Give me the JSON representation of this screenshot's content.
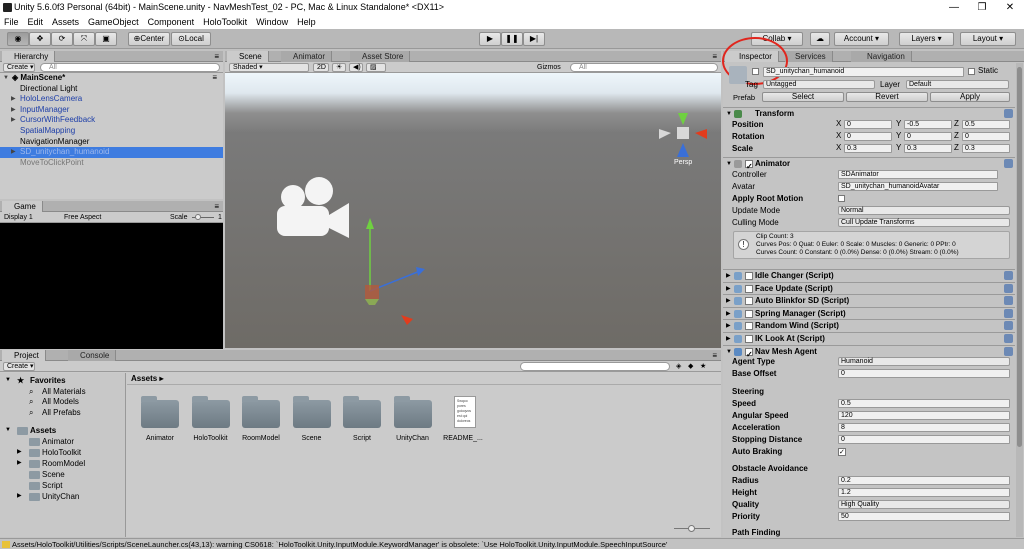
{
  "window": {
    "title": "Unity 5.6.0f3 Personal (64bit) - MainScene.unity - NavMeshTest_02 - PC, Mac & Linux Standalone* <DX11>",
    "min": "—",
    "max": "❐",
    "close": "✕"
  },
  "menu": [
    "File",
    "Edit",
    "Assets",
    "GameObject",
    "Component",
    "HoloToolkit",
    "Window",
    "Help"
  ],
  "toolbar": {
    "center": "Center",
    "local": "Local",
    "collab": "Collab",
    "account": "Account",
    "layers": "Layers",
    "layout": "Layout"
  },
  "hierarchy": {
    "tab": "Hierarchy",
    "create": "Create",
    "search": "All",
    "scene": "MainScene*",
    "items": [
      {
        "label": "Directional Light",
        "style": "normal",
        "arrow": ""
      },
      {
        "label": "HoloLensCamera",
        "style": "blue",
        "arrow": "▶"
      },
      {
        "label": "InputManager",
        "style": "blue",
        "arrow": "▶"
      },
      {
        "label": "CursorWithFeedback",
        "style": "blue",
        "arrow": "▶"
      },
      {
        "label": "SpatialMapping",
        "style": "blue",
        "arrow": ""
      },
      {
        "label": "NavigationManager",
        "style": "normal",
        "arrow": ""
      },
      {
        "label": "SD_unitychan_humanoid",
        "style": "sel",
        "arrow": "▶"
      },
      {
        "label": "MoveToClickPoint",
        "style": "gray",
        "arrow": ""
      }
    ]
  },
  "scene": {
    "tabs": [
      "Scene",
      "Animator",
      "Asset Store"
    ],
    "shaded": "Shaded",
    "mode2d": "2D",
    "gizmos": "Gizmos",
    "search": "All",
    "persp": "Persp"
  },
  "game": {
    "tab": "Game",
    "display": "Display 1",
    "aspect": "Free Aspect",
    "scale": "Scale",
    "scale_val": "1"
  },
  "project": {
    "tabs": [
      "Project",
      "Console"
    ],
    "create": "Create",
    "breadcrumb": "Assets",
    "tree": [
      {
        "label": "Favorites",
        "bold": true
      },
      {
        "label": "All Materials"
      },
      {
        "label": "All Models"
      },
      {
        "label": "All Prefabs"
      },
      {
        "label": "Assets",
        "bold": true
      },
      {
        "label": "Animator"
      },
      {
        "label": "HoloToolkit"
      },
      {
        "label": "RoomModel"
      },
      {
        "label": "Scene"
      },
      {
        "label": "Script"
      },
      {
        "label": "UnityChan"
      }
    ],
    "assets": [
      "Animator",
      "HoloToolkit",
      "RoomModel",
      "Scene",
      "Script",
      "UnityChan",
      "README_..."
    ],
    "readme_preview": "Swqoo pores goioqvos est qoi duloreos"
  },
  "status": "Assets/HoloToolkit/Utilities/Scripts/SceneLauncher.cs(43,13): warning CS0618: `HoloToolkit.Unity.InputModule.KeywordManager' is obsolete: `Use HoloToolkit.Unity.InputModule.SpeechInputSource'",
  "inspector": {
    "tabs": [
      "Inspector",
      "Services",
      "Navigation"
    ],
    "name": "SD_unitychan_humanoid",
    "static": "Static",
    "tag_label": "Tag",
    "tag": "Untagged",
    "layer_label": "Layer",
    "layer": "Default",
    "prefab": "Prefab",
    "select": "Select",
    "revert": "Revert",
    "apply": "Apply",
    "transform": {
      "title": "Transform",
      "position": "Position",
      "rotation": "Rotation",
      "scale": "Scale",
      "px": "0",
      "py": "-0.5",
      "pz": "0.5",
      "rx": "0",
      "ry": "0",
      "rz": "0",
      "sx": "0.3",
      "sy": "0.3",
      "sz": "0.3"
    },
    "animator": {
      "title": "Animator",
      "controller_label": "Controller",
      "controller": "SDAnimator",
      "avatar_label": "Avatar",
      "avatar": "SD_unitychan_humanoidAvatar",
      "root_motion": "Apply Root Motion",
      "update_mode_label": "Update Mode",
      "update_mode": "Normal",
      "culling_label": "Culling Mode",
      "culling": "Cull Update Transforms",
      "info": [
        "Clip Count: 3",
        "Curves Pos: 0 Quat: 0 Euler: 0 Scale: 0 Muscles: 0 Generic: 0 PPtr: 0",
        "Curves Count: 0 Constant: 0 (0.0%) Dense: 0 (0.0%) Stream: 0 (0.0%)"
      ]
    },
    "scripts": [
      "Idle Changer (Script)",
      "Face Update (Script)",
      "Auto Blinkfor SD (Script)",
      "Spring Manager (Script)",
      "Random Wind (Script)",
      "IK Look At (Script)"
    ],
    "nav": {
      "title": "Nav Mesh Agent",
      "agent_type_label": "Agent Type",
      "agent_type": "Humanoid",
      "base_offset_label": "Base Offset",
      "base_offset": "0",
      "steering": "Steering",
      "speed_label": "Speed",
      "speed": "0.5",
      "ang_label": "Angular Speed",
      "ang": "120",
      "acc_label": "Acceleration",
      "acc": "8",
      "stop_label": "Stopping Distance",
      "stop": "0",
      "brake_label": "Auto Braking",
      "obstacle": "Obstacle Avoidance",
      "radius_label": "Radius",
      "radius": "0.2",
      "height_label": "Height",
      "height": "1.2",
      "quality_label": "Quality",
      "quality": "High Quality",
      "priority_label": "Priority",
      "priority": "50",
      "path": "Path Finding"
    }
  },
  "axes": {
    "x": "X",
    "y": "Y",
    "z": "Z"
  }
}
